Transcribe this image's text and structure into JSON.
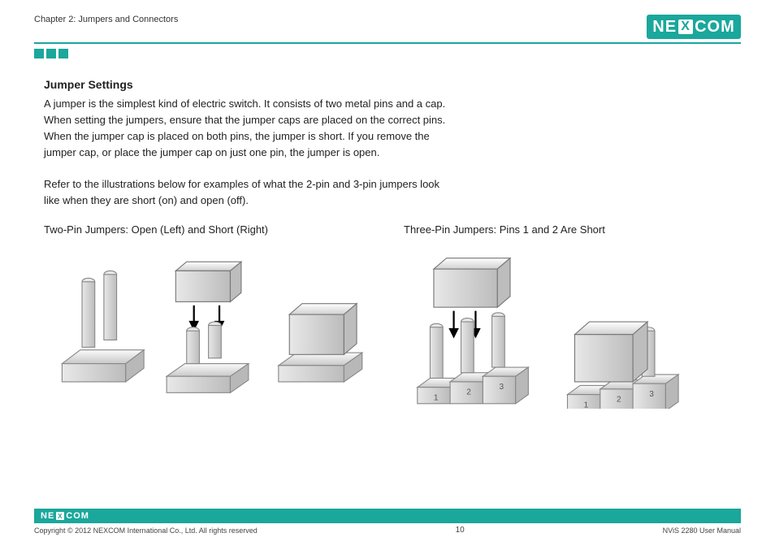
{
  "brand": {
    "name": "NEXCOM",
    "letters_left": "NE",
    "letters_x": "X",
    "letters_right": "COM"
  },
  "header": {
    "chapter": "Chapter 2: Jumpers and Connectors"
  },
  "main": {
    "heading": "Jumper Settings",
    "para1": "A jumper is the simplest kind of electric switch. It consists of two metal pins and a cap. When setting the jumpers, ensure that the jumper caps are placed on the correct pins. When the jumper cap is placed on both pins, the jumper is short. If you remove the jumper cap, or place the jumper cap on just one pin, the jumper is open.",
    "para2": "Refer to the illustrations below for examples of what the 2-pin and 3-pin jumpers look like when they are short (on) and open (off).",
    "left_caption": "Two-Pin Jumpers: Open (Left) and Short (Right)",
    "right_caption": "Three-Pin Jumpers: Pins 1 and 2 Are Short"
  },
  "footer": {
    "copyright": "Copyright © 2012 NEXCOM International Co., Ltd. All rights reserved",
    "page": "10",
    "doc": "NViS 2280 User Manual"
  }
}
